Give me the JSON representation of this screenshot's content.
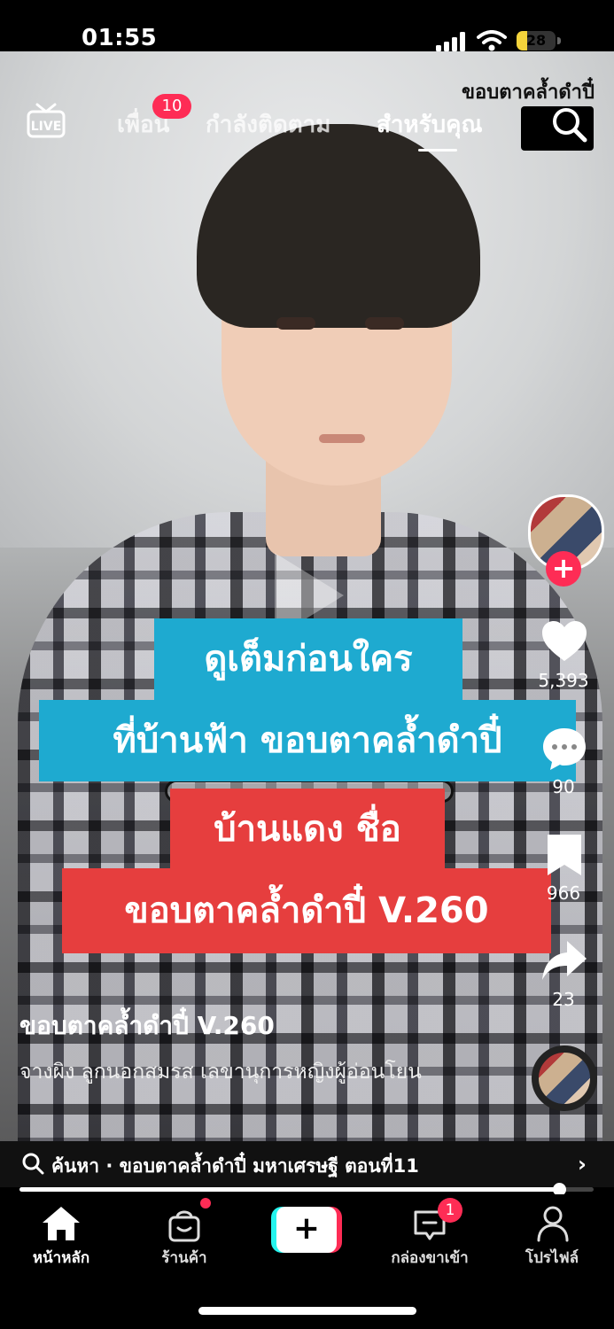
{
  "status": {
    "time": "01:55",
    "battery": "28",
    "battery_level": 0.28
  },
  "overlay_title": "ขอบตาคล้ำดำปี๋",
  "nav": {
    "live_icon": "live-icon",
    "friends": "เพื่อน",
    "friends_badge": "10",
    "following": "กำลังติดตาม",
    "for_you": "สำหรับคุณ",
    "search_icon": "search-icon"
  },
  "captions": {
    "line1": "ดูเต็มก่อนใคร",
    "line2": "ที่บ้านฟ้า ขอบตาคล้ำดำปี๋",
    "line3": "บ้านแดง ชื่อ",
    "line4": "ขอบตาคล้ำดำปี๋ V.260"
  },
  "actions": {
    "likes": "5,393",
    "comments": "90",
    "saves": "966",
    "shares": "23"
  },
  "video": {
    "title": "ขอบตาคล้ำดำปี๋ V.260",
    "description": "จางผิง ลูกนอกสมรส เลขานุการหญิงผู้อ่อนโยน"
  },
  "search_suggestion": "ค้นหา · ขอบตาคล้ำดำปี๋ มหาเศรษฐี ตอนที่11",
  "progress": 0.94,
  "tabs": {
    "home": "หน้าหลัก",
    "shop": "ร้านค้า",
    "inbox": "กล่องขาเข้า",
    "inbox_badge": "1",
    "profile": "โปรไฟล์"
  },
  "colors": {
    "accent": "#fe2c55",
    "caption_blue": "#1eaad0",
    "caption_red": "#e63e3e",
    "battery": "#f3d33b"
  }
}
